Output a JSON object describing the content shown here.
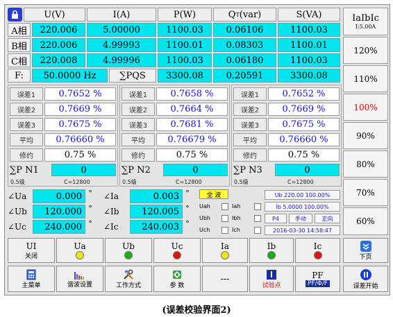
{
  "header": {
    "u": "U(V)",
    "i": "I(A)",
    "p": "P(W)",
    "q": "Q",
    "q_sub": "T",
    "q_unit": "(var)",
    "s": "S(VA)"
  },
  "phases": [
    {
      "label": "A相",
      "u": "220.006",
      "i": "5.00000",
      "p": "1100.03",
      "q": "0.06106",
      "s": "1100.03"
    },
    {
      "label": "B相",
      "u": "220.006",
      "i": "4.99993",
      "p": "1100.01",
      "q": "0.08303",
      "s": "1100.01"
    },
    {
      "label": "C相",
      "u": "220.008",
      "i": "4.99996",
      "p": "1100.03",
      "q": "0.06180",
      "s": "1100.03"
    }
  ],
  "freq": {
    "label": "F:",
    "value": "50.0000 Hz",
    "sum_label": "∑PQS",
    "p": "3300.08",
    "q": "0.20591",
    "s": "3300.08"
  },
  "groups": [
    {
      "err1": "0.7652 %",
      "err2": "0.7669 %",
      "err3": "0.7675 %",
      "avg": "0.76660 %",
      "round": "0.75 %",
      "n_label": "∑P N1",
      "n_value": "0",
      "grade": "0.5级",
      "c": "C=12800"
    },
    {
      "err1": "0.7658 %",
      "err2": "0.7664 %",
      "err3": "0.7681 %",
      "avg": "0.76679 %",
      "round": "0.75 %",
      "n_label": "∑P N2",
      "n_value": "0",
      "grade": "0.5级",
      "c": "C=12800"
    },
    {
      "err1": "0.7652 %",
      "err2": "0.7669 %",
      "err3": "0.7675 %",
      "avg": "0.76660 %",
      "round": "0.75 %",
      "n_label": "∑P N3",
      "n_value": "0",
      "grade": "0.5级",
      "c": "C=12800"
    }
  ],
  "row_labels": {
    "err1": "误差1",
    "err2": "误差2",
    "err3": "误差3",
    "avg": "平均",
    "round": "修约"
  },
  "angles": {
    "ua_label": "∠Ua",
    "ua": "0.000",
    "ub_label": "∠Ub",
    "ub": "120.000",
    "uc_label": "∠Uc",
    "uc": "240.000",
    "ia_label": "∠Ia",
    "ia": "0.003",
    "ib_label": "∠Ib",
    "ib": "120.005",
    "ic_label": "∠Ic",
    "ic": "240.003",
    "deg": "°"
  },
  "harmonic": {
    "all": "全 波",
    "uah": "Uah",
    "ubh": "Ubh",
    "uch": "Uch",
    "iah": "Iah",
    "ibh": "Ibh",
    "ich": "Ich"
  },
  "status": {
    "ub": "Ub 220.00 100.00%",
    "ib": "Ib 5.0000 100.00%",
    "p4": "P4",
    "manual": "手动",
    "forward": "正向",
    "datetime": "2016-03-30 14:58:47"
  },
  "side": {
    "title": "IaIbIc",
    "range": "I:5.00A",
    "levels": [
      "120%",
      "110%",
      "100%",
      "90%",
      "80%",
      "70%",
      "60%"
    ],
    "active_color": "#e00000"
  },
  "indicators": [
    {
      "label": "UI",
      "sub": "关闭"
    },
    {
      "label": "Ua",
      "color": "#f2e600"
    },
    {
      "label": "Ub",
      "color": "#16b016"
    },
    {
      "label": "Uc",
      "color": "#e01010"
    },
    {
      "label": "Ia",
      "color": "#f2e600"
    },
    {
      "label": "Ib",
      "color": "#16b016"
    },
    {
      "label": "Ic",
      "color": "#e01010"
    }
  ],
  "next_page": "下页",
  "buttons": [
    {
      "label": "主菜单"
    },
    {
      "label": "谐波设置"
    },
    {
      "label": "工作方式"
    },
    {
      "label": "参 数"
    },
    {
      "label": "---"
    },
    {
      "label": "试验点"
    },
    {
      "top": "PF",
      "label": "PF/Φ/F"
    },
    {
      "label": "误差开始"
    }
  ],
  "caption": "(误差校验界面2)"
}
